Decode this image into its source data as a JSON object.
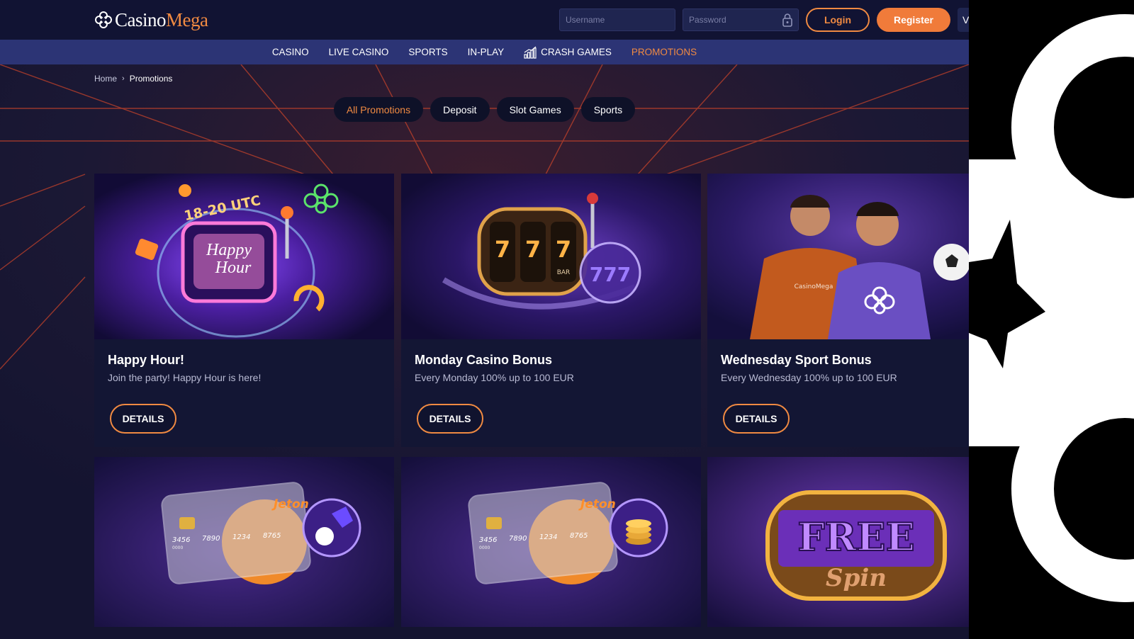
{
  "header": {
    "logo_casino": "Casino",
    "logo_mega": "Mega",
    "username_placeholder": "Username",
    "password_placeholder": "Password",
    "login_label": "Login",
    "register_label": "Register",
    "lang_label": "V"
  },
  "nav": {
    "items": [
      "CASINO",
      "LIVE CASINO",
      "SPORTS",
      "IN-PLAY",
      "CRASH GAMES",
      "PROMOTIONS"
    ]
  },
  "breadcrumb": {
    "home": "Home",
    "current": "Promotions"
  },
  "filters": [
    "All Promotions",
    "Deposit",
    "Slot Games",
    "Sports"
  ],
  "promotions": [
    {
      "title": "Happy Hour!",
      "subtitle": "Join the party! Happy Hour is here!",
      "button": "DETAILS",
      "image_text1": "18-20 UTC",
      "image_text2": "Happy",
      "image_text3": "Hour"
    },
    {
      "title": "Monday Casino Bonus",
      "subtitle": "Every Monday 100% up to 100 EUR",
      "button": "DETAILS",
      "image_text1": "BAR",
      "image_text2": "7",
      "image_text3": "777"
    },
    {
      "title": "Wednesday Sport Bonus",
      "subtitle": "Every Wednesday 100% up to 100 EUR",
      "button": "DETAILS",
      "image_text1": "CasinoMega"
    },
    {
      "image_brand": "Jeton",
      "card_numbers": [
        "3456",
        "7890",
        "1234",
        "8765"
      ],
      "card_small": "0000"
    },
    {
      "image_brand": "Jeton",
      "card_numbers": [
        "3456",
        "7890",
        "1234",
        "8765"
      ],
      "card_small": "0000"
    },
    {
      "image_text1": "FREE",
      "image_text2": "Spin"
    }
  ],
  "colors": {
    "accent": "#f08a42",
    "nav_bg": "#2c3475",
    "header_bg": "#111333",
    "page_bg": "#161530"
  }
}
